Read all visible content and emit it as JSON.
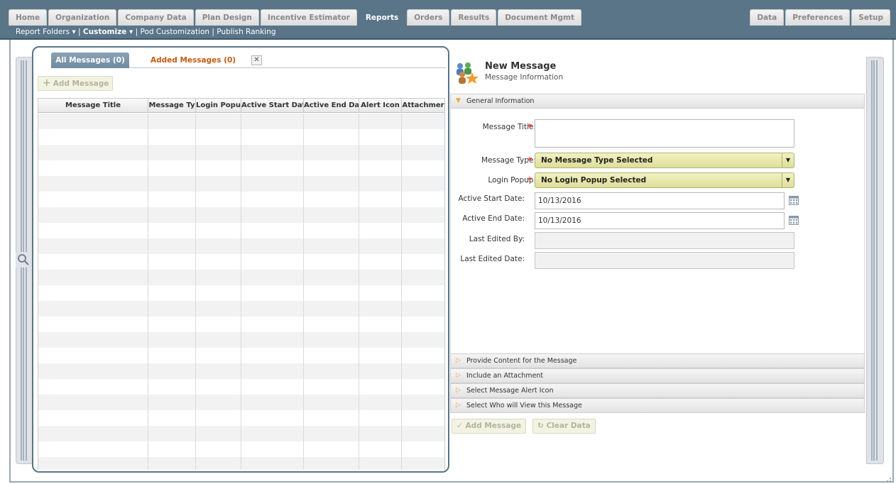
{
  "nav": {
    "tabs_left": [
      "Home",
      "Organization",
      "Company Data",
      "Plan Design",
      "Incentive Estimator",
      "Reports",
      "Orders",
      "Results",
      "Document Mgmt"
    ],
    "active_tab": "Reports",
    "tabs_right": [
      "Data",
      "Preferences",
      "Setup"
    ],
    "subnav": {
      "report_folders": "Report Folders ▾",
      "sep1": " | ",
      "customize": "Customize ▾",
      "sep2": " | ",
      "pod_customization": "Pod Customization",
      "sep3": " | ",
      "publish_ranking": "Publish Ranking"
    }
  },
  "messages_panel": {
    "tab_all": "All Messages (0)",
    "tab_added": "Added Messages (0)",
    "close_glyph": "✕",
    "add_button": "Add Message",
    "columns": [
      "Message Title",
      "Message Ty",
      "Login Popu",
      "Active Start Date",
      "Active End Date",
      "Alert Icon",
      "Attachmer"
    ]
  },
  "new_message": {
    "title": "New Message",
    "subtitle": "Message Information",
    "sections": {
      "general": "General Information",
      "content": "Provide Content for the Message",
      "attachment": "Include an Attachment",
      "alert_icon": "Select Message Alert Icon",
      "viewers": "Select Who will View this Message"
    },
    "fields": {
      "message_title_label": "Message Title:",
      "message_title_value": "",
      "message_type_label": "Message Type:",
      "message_type_value": "No Message Type Selected",
      "login_popup_label": "Login Popup:",
      "login_popup_value": "No Login Popup Selected",
      "active_start_label": "Active Start Date:",
      "active_start_value": "10/13/2016",
      "active_end_label": "Active End Date:",
      "active_end_value": "10/13/2016",
      "last_edited_by_label": "Last Edited By:",
      "last_edited_by_value": "",
      "last_edited_date_label": "Last Edited Date:",
      "last_edited_date_value": ""
    },
    "required_mark": "*",
    "buttons": {
      "add": "Add Message",
      "clear": "Clear Data"
    }
  },
  "colors": {
    "nav_bg": "#5a7588",
    "accent_orange": "#c55a11",
    "required_red": "#e23c3c",
    "select_bg": "#e8e8ad"
  }
}
